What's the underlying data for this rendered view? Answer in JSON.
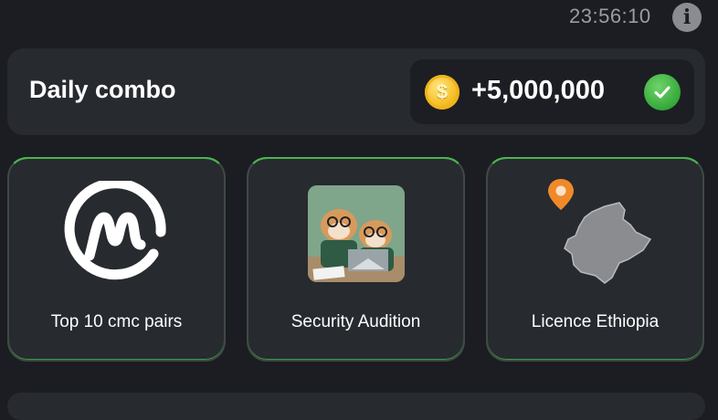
{
  "header": {
    "timer": "23:56:10",
    "info_icon": "info-icon"
  },
  "daily_combo": {
    "title": "Daily combo",
    "reward": "+5,000,000",
    "coin_icon": "coin-icon",
    "check_icon": "check-circle-icon"
  },
  "cards": [
    {
      "label": "Top 10 cmc pairs",
      "icon": "coinmarketcap-logo-icon"
    },
    {
      "label": "Security Audition",
      "icon": "hamsters-audit-image"
    },
    {
      "label": "Licence Ethiopia",
      "icon": "ethiopia-map-icon"
    }
  ],
  "colors": {
    "background": "#1b1d22",
    "card": "#272a2f",
    "card_border": "#4bb452",
    "coin": "#f6c028",
    "check": "#35a83a",
    "pin": "#f0892a"
  }
}
